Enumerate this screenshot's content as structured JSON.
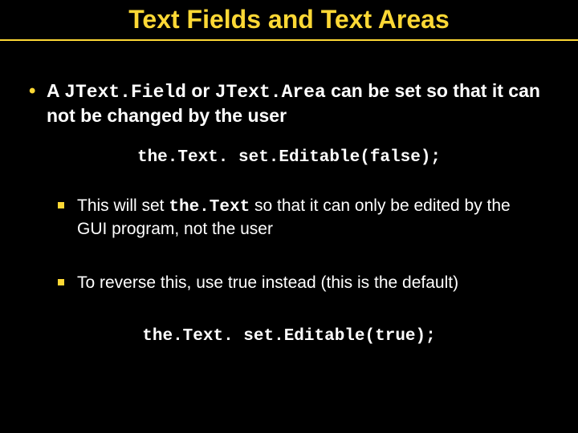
{
  "title": "Text Fields and Text Areas",
  "bullet1": {
    "pre": "A ",
    "code1": "JText.Field",
    "mid": " or ",
    "code2": "JText.Area",
    "post": " can be set so that it can not be changed by the user"
  },
  "code_false": "the.Text. set.Editable(false);",
  "sub1": {
    "pre": "This will set ",
    "code": "the.Text",
    "post": " so that it can only be edited by the GUI program, not the user"
  },
  "sub2": "To reverse this, use true instead (this is the default)",
  "code_true": "the.Text. set.Editable(true);"
}
